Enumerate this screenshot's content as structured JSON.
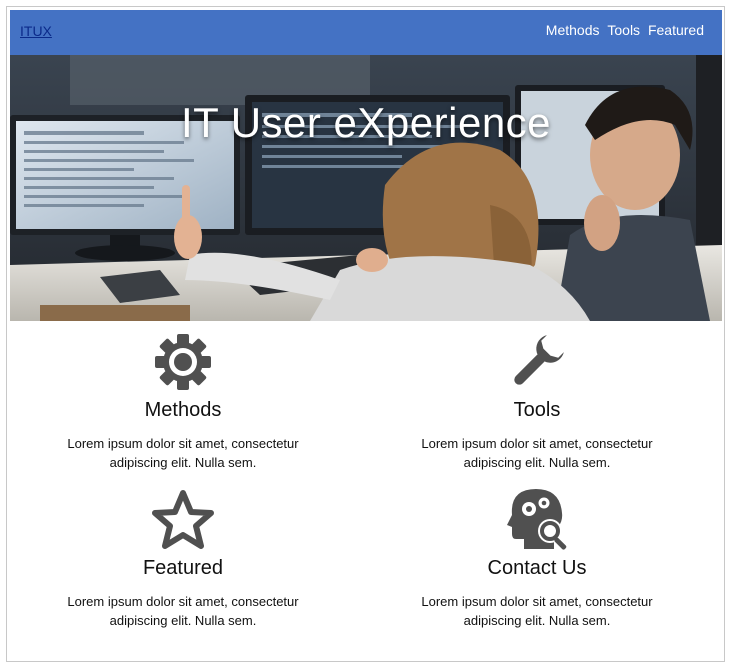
{
  "navbar": {
    "brand": "ITUX",
    "links": [
      "Methods",
      "Tools",
      "Featured"
    ]
  },
  "hero": {
    "title": "IT User eXperience"
  },
  "features": [
    {
      "title": "Methods",
      "icon": "gear-icon",
      "text": "Lorem ipsum dolor sit amet, consectetur adipiscing elit. Nulla sem."
    },
    {
      "title": "Tools",
      "icon": "wrench-icon",
      "text": "Lorem ipsum dolor sit amet, consectetur adipiscing elit. Nulla sem."
    },
    {
      "title": "Featured",
      "icon": "star-icon",
      "text": "Lorem ipsum dolor sit amet, consectetur adipiscing elit. Nulla sem."
    },
    {
      "title": "Contact Us",
      "icon": "head-gears-search-icon",
      "text": "Lorem ipsum dolor sit amet, consectetur adipiscing elit. Nulla sem."
    }
  ],
  "colors": {
    "navbar": "#4472c4",
    "icon": "#505050"
  }
}
